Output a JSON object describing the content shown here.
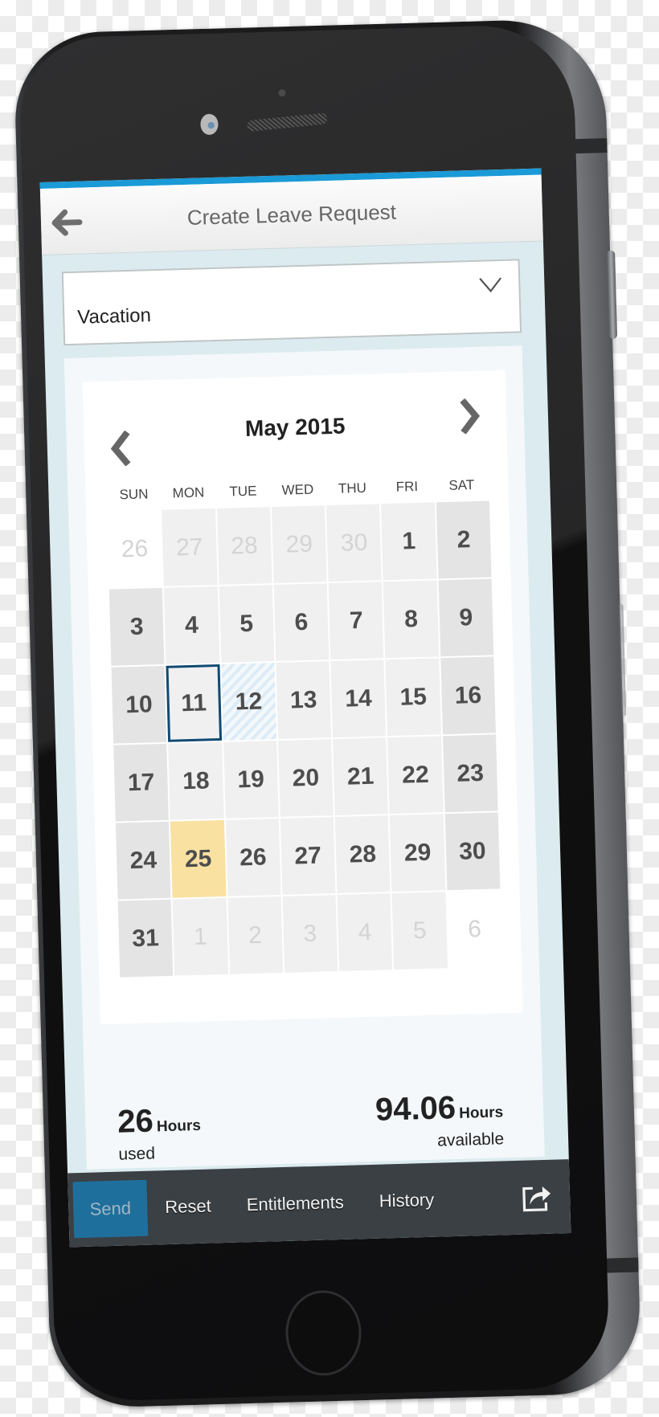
{
  "header": {
    "title": "Create Leave Request",
    "back_icon": "arrow-left-icon"
  },
  "leave_type": {
    "selected": "Vacation",
    "icon": "chevron-down-icon"
  },
  "calendar": {
    "month_label": "May 2015",
    "prev_icon": "chevron-left-icon",
    "next_icon": "chevron-right-icon",
    "weekdays": [
      "SUN",
      "MON",
      "TUE",
      "WED",
      "THU",
      "FRI",
      "SAT"
    ],
    "days": [
      {
        "label": "26",
        "state": "other-blank"
      },
      {
        "label": "27",
        "state": "other"
      },
      {
        "label": "28",
        "state": "other"
      },
      {
        "label": "29",
        "state": "other"
      },
      {
        "label": "30",
        "state": "other"
      },
      {
        "label": "1",
        "state": "normal"
      },
      {
        "label": "2",
        "state": "weekend"
      },
      {
        "label": "3",
        "state": "weekend"
      },
      {
        "label": "4",
        "state": "normal"
      },
      {
        "label": "5",
        "state": "normal"
      },
      {
        "label": "6",
        "state": "normal"
      },
      {
        "label": "7",
        "state": "normal"
      },
      {
        "label": "8",
        "state": "normal"
      },
      {
        "label": "9",
        "state": "weekend"
      },
      {
        "label": "10",
        "state": "weekend"
      },
      {
        "label": "11",
        "state": "selected"
      },
      {
        "label": "12",
        "state": "pending"
      },
      {
        "label": "13",
        "state": "normal"
      },
      {
        "label": "14",
        "state": "normal"
      },
      {
        "label": "15",
        "state": "normal"
      },
      {
        "label": "16",
        "state": "weekend"
      },
      {
        "label": "17",
        "state": "weekend"
      },
      {
        "label": "18",
        "state": "normal"
      },
      {
        "label": "19",
        "state": "normal"
      },
      {
        "label": "20",
        "state": "normal"
      },
      {
        "label": "21",
        "state": "normal"
      },
      {
        "label": "22",
        "state": "normal"
      },
      {
        "label": "23",
        "state": "weekend"
      },
      {
        "label": "24",
        "state": "weekend"
      },
      {
        "label": "25",
        "state": "today"
      },
      {
        "label": "26",
        "state": "normal"
      },
      {
        "label": "27",
        "state": "normal"
      },
      {
        "label": "28",
        "state": "normal"
      },
      {
        "label": "29",
        "state": "normal"
      },
      {
        "label": "30",
        "state": "weekend"
      },
      {
        "label": "31",
        "state": "weekend"
      },
      {
        "label": "1",
        "state": "other"
      },
      {
        "label": "2",
        "state": "other"
      },
      {
        "label": "3",
        "state": "other"
      },
      {
        "label": "4",
        "state": "other"
      },
      {
        "label": "5",
        "state": "other"
      },
      {
        "label": "6",
        "state": "other-blank"
      }
    ]
  },
  "balance": {
    "used_value": "26",
    "used_unit": "Hours",
    "used_label": "used",
    "available_value": "94.06",
    "available_unit": "Hours",
    "available_label": "available"
  },
  "footer": {
    "send": "Send",
    "reset": "Reset",
    "entitlements": "Entitlements",
    "history": "History",
    "share_icon": "share-icon"
  },
  "colors": {
    "accent_top_line": "#1a9ad6",
    "send_button": "#1f6f9c",
    "selected_border": "#0f4a73",
    "today_highlight": "#f9e1a2",
    "pending_stripe": "#dcebf5",
    "tabbar": "#3b4044"
  }
}
